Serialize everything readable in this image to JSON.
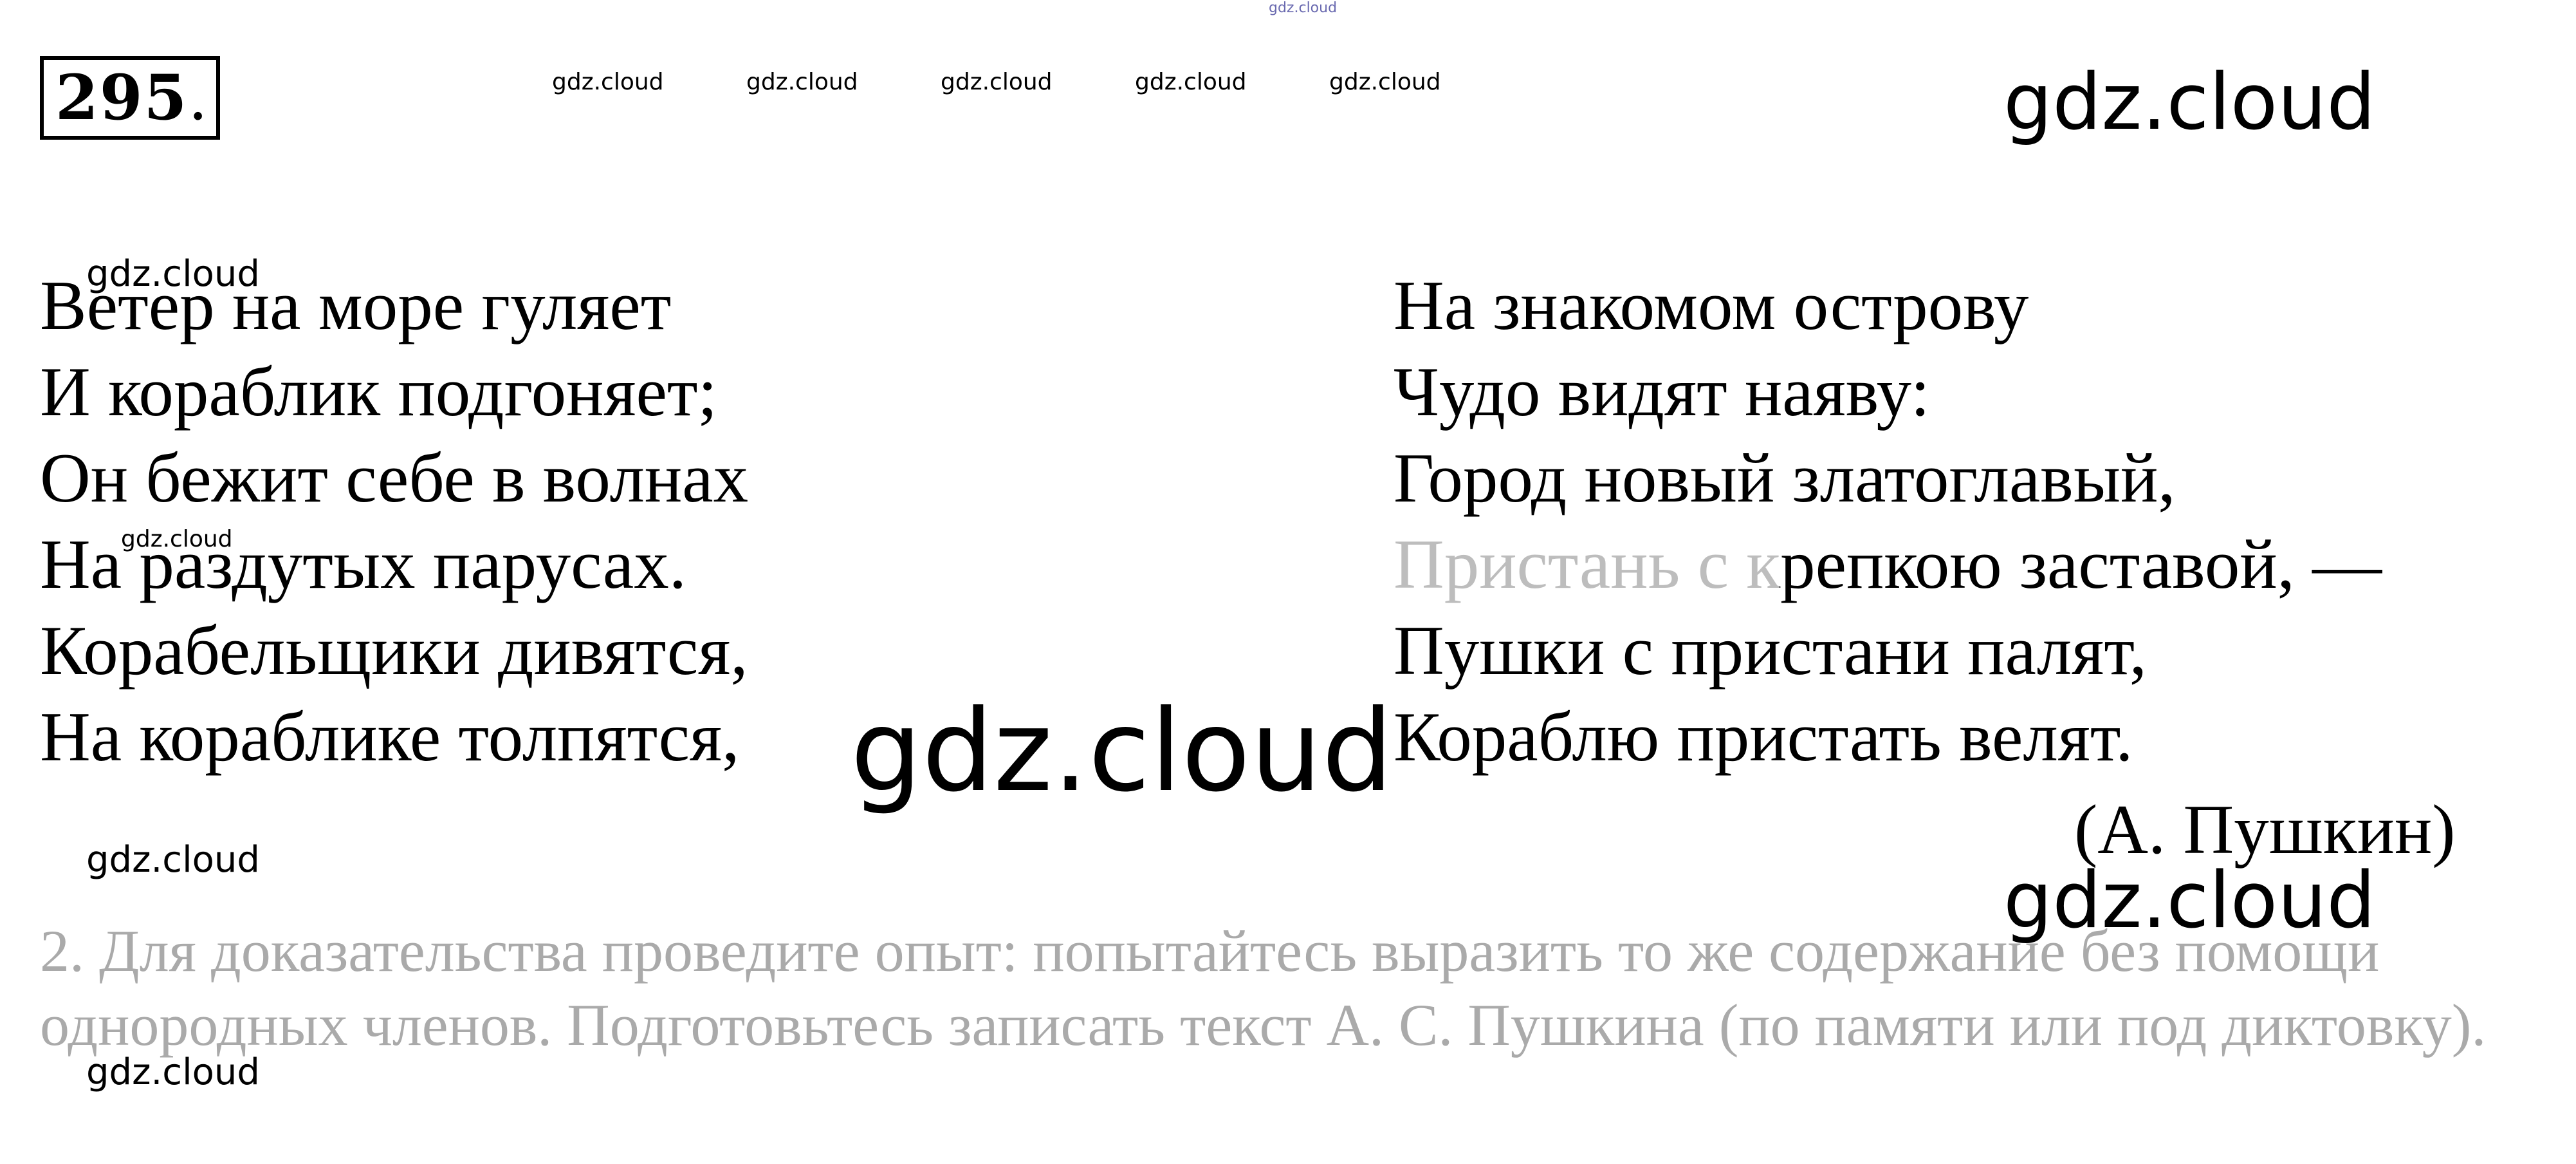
{
  "exercise": {
    "number": "295",
    "dot": "."
  },
  "poem": {
    "left": [
      "Ветер на море гуляет",
      "И кораблик подгоняет;",
      "Он бежит себе в волнах",
      "На раздутых парусах.",
      "Корабельщики дивятся,",
      "На кораблике толпятся,"
    ],
    "right": [
      "На знакомом острову",
      "Чудо видят наяву:",
      "Город новый златоглавый,",
      "Пристань с крепкою заставой, —",
      "Пушки с пристани палят,",
      "Кораблю пристать велят."
    ],
    "author": "(А. Пушкин)"
  },
  "task": {
    "text": "2. Для доказательства проведите опыт: попытайтесь выразить то же содержание без помощи однородных членов. Подготовьтесь записать текст А. С. Пушкина (по памяти или под диктовку)."
  },
  "watermark": {
    "text": "gdz.cloud"
  }
}
